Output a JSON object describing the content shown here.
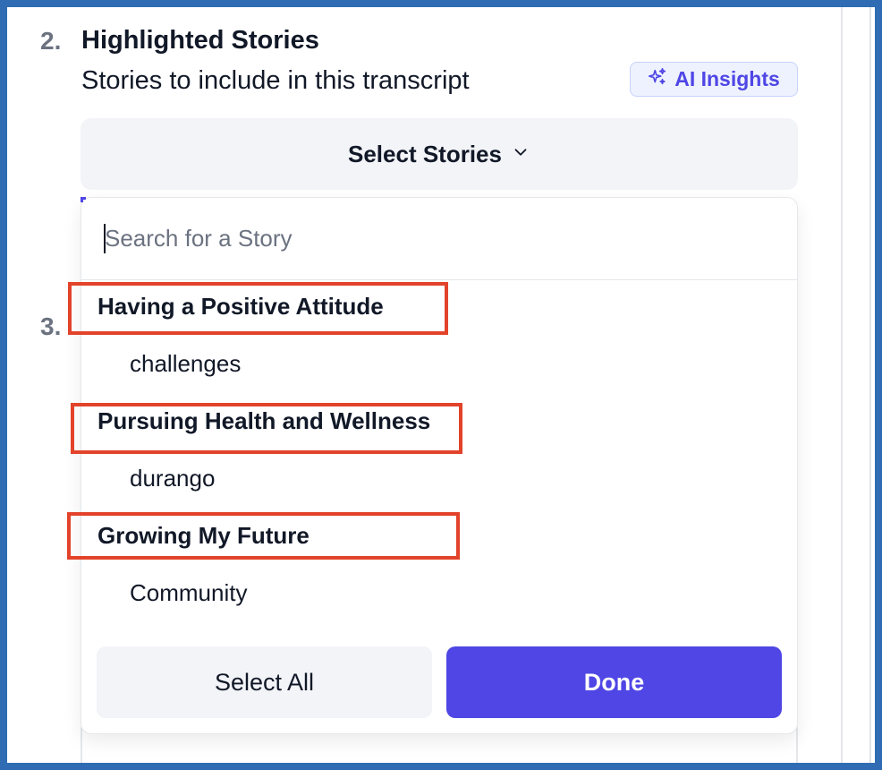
{
  "section": {
    "step_number": "2.",
    "title": "Highlighted Stories",
    "subtitle": "Stories to include in this transcript",
    "ai_insights_label": "AI Insights"
  },
  "next_step_number": "3.",
  "select": {
    "label": "Select Stories"
  },
  "dropdown": {
    "search_placeholder": "Search for a Story",
    "stories": [
      {
        "label": "Having a Positive Attitude",
        "level": "parent",
        "highlighted": true
      },
      {
        "label": "challenges",
        "level": "child",
        "highlighted": false
      },
      {
        "label": "Pursuing Health and Wellness",
        "level": "parent",
        "highlighted": true
      },
      {
        "label": "durango",
        "level": "child",
        "highlighted": false
      },
      {
        "label": "Growing My Future",
        "level": "parent",
        "highlighted": true
      },
      {
        "label": "Community",
        "level": "child",
        "highlighted": false
      }
    ],
    "select_all_label": "Select All",
    "done_label": "Done"
  },
  "colors": {
    "accent": "#4f46e5",
    "highlight_box": "#e2432a",
    "frame": "#2f6cb4"
  }
}
